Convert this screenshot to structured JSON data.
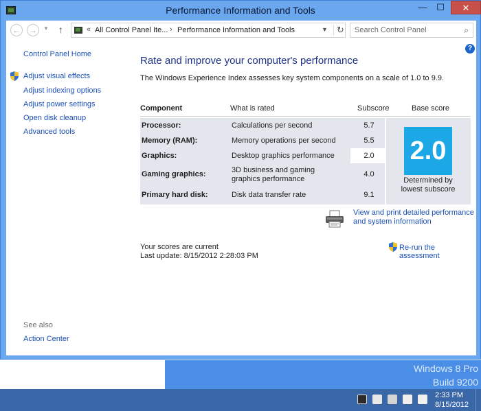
{
  "window": {
    "title": "Performance Information and Tools",
    "minimize_glyph": "—",
    "maximize_glyph": "☐",
    "close_glyph": "✕"
  },
  "navigation": {
    "back_glyph": "←",
    "forward_glyph": "→",
    "up_glyph": "↑",
    "breadcrumb_sep_start": "«",
    "breadcrumb": [
      "All Control Panel Ite...",
      "Performance Information and Tools"
    ],
    "breadcrumb_sep": "›",
    "search_placeholder": "Search Control Panel"
  },
  "sidebar": {
    "home": "Control Panel Home",
    "items": [
      {
        "label": "Adjust visual effects",
        "shield": true
      },
      {
        "label": "Adjust indexing options"
      },
      {
        "label": "Adjust power settings"
      },
      {
        "label": "Open disk cleanup"
      },
      {
        "label": "Advanced tools"
      }
    ],
    "see_also_title": "See also",
    "see_also_items": [
      "Action Center"
    ]
  },
  "main": {
    "help_glyph": "?",
    "heading": "Rate and improve your computer's performance",
    "intro": "The Windows Experience Index assesses key system components on a scale of 1.0 to 9.9.",
    "table": {
      "headers": {
        "component": "Component",
        "what": "What is rated",
        "subscore": "Subscore",
        "base": "Base score"
      },
      "rows": [
        {
          "component": "Processor:",
          "what": "Calculations per second",
          "subscore": "5.7"
        },
        {
          "component": "Memory (RAM):",
          "what": "Memory operations per second",
          "subscore": "5.5"
        },
        {
          "component": "Graphics:",
          "what": "Desktop graphics performance",
          "subscore": "2.0"
        },
        {
          "component": "Gaming graphics:",
          "what": "3D business and gaming",
          "what2": "graphics performance",
          "subscore": "4.0"
        },
        {
          "component": "Primary hard disk:",
          "what": "Disk data transfer rate",
          "subscore": "9.1"
        }
      ],
      "base_score": "2.0",
      "base_caption1": "Determined by",
      "base_caption2": "lowest subscore"
    },
    "detail_link1": "View and print detailed performance",
    "detail_link2": "and system information",
    "status": "Your scores are current",
    "last_update": "Last update: 8/15/2012 2:28:03 PM",
    "rerun": "Re-run the assessment"
  },
  "desktop": {
    "watermark1": "Windows 8 Pro",
    "watermark2": "Build 9200"
  },
  "taskbar": {
    "time": "2:33 PM",
    "date": "8/15/2012"
  },
  "colors": {
    "accent": "#1ca7e6",
    "link": "#1a50b8",
    "titlebar": "#6aa7ee",
    "taskbar": "#3a67a8"
  }
}
